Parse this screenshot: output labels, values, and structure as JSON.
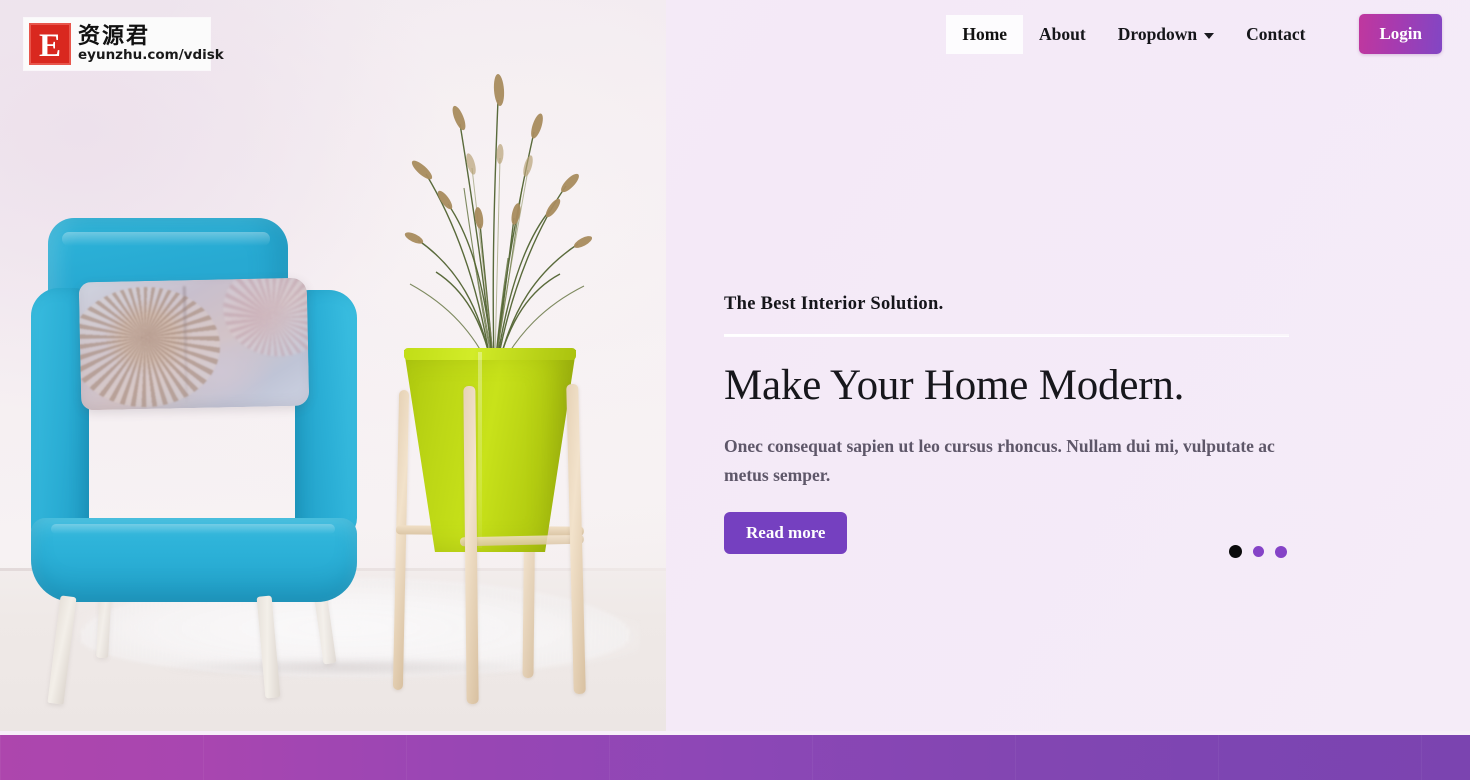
{
  "brand": {
    "watermark_letter": "E",
    "watermark_cn": "资源君",
    "watermark_url": "eyunzhu.com/vdisk",
    "watermark_box_color": "#d9281f"
  },
  "navbar": {
    "items": [
      {
        "label": "Home",
        "active": true,
        "has_caret": false
      },
      {
        "label": "About",
        "active": false,
        "has_caret": false
      },
      {
        "label": "Dropdown",
        "active": false,
        "has_caret": true
      },
      {
        "label": "Contact",
        "active": false,
        "has_caret": false
      }
    ],
    "login_label": "Login",
    "login_gradient_from": "#c0379e",
    "login_gradient_to": "#8246c4",
    "active_bg": "#fdfcfe"
  },
  "hero": {
    "eyebrow": "The Best Interior Solution.",
    "headline": "Make Your Home Modern.",
    "body": "Onec consequat sapien ut leo cursus rhoncus. Nullam dui mi, vulputate ac metus semper.",
    "cta_label": "Read more",
    "cta_color": "#7540c0",
    "background_color": "#f5ebf8",
    "image_alt": "Blue velvet armchair with floral pillow beside a lime green potted ornamental grass on a wooden stand over a white shag rug"
  },
  "carousel": {
    "slide_count": 3,
    "active_index": 0,
    "active_dot_color": "#0b0b0c",
    "inactive_dot_color": "#8543c7"
  },
  "footer_bar": {
    "gradient_from": "#ad46ad",
    "gradient_to": "#7b44b0"
  }
}
